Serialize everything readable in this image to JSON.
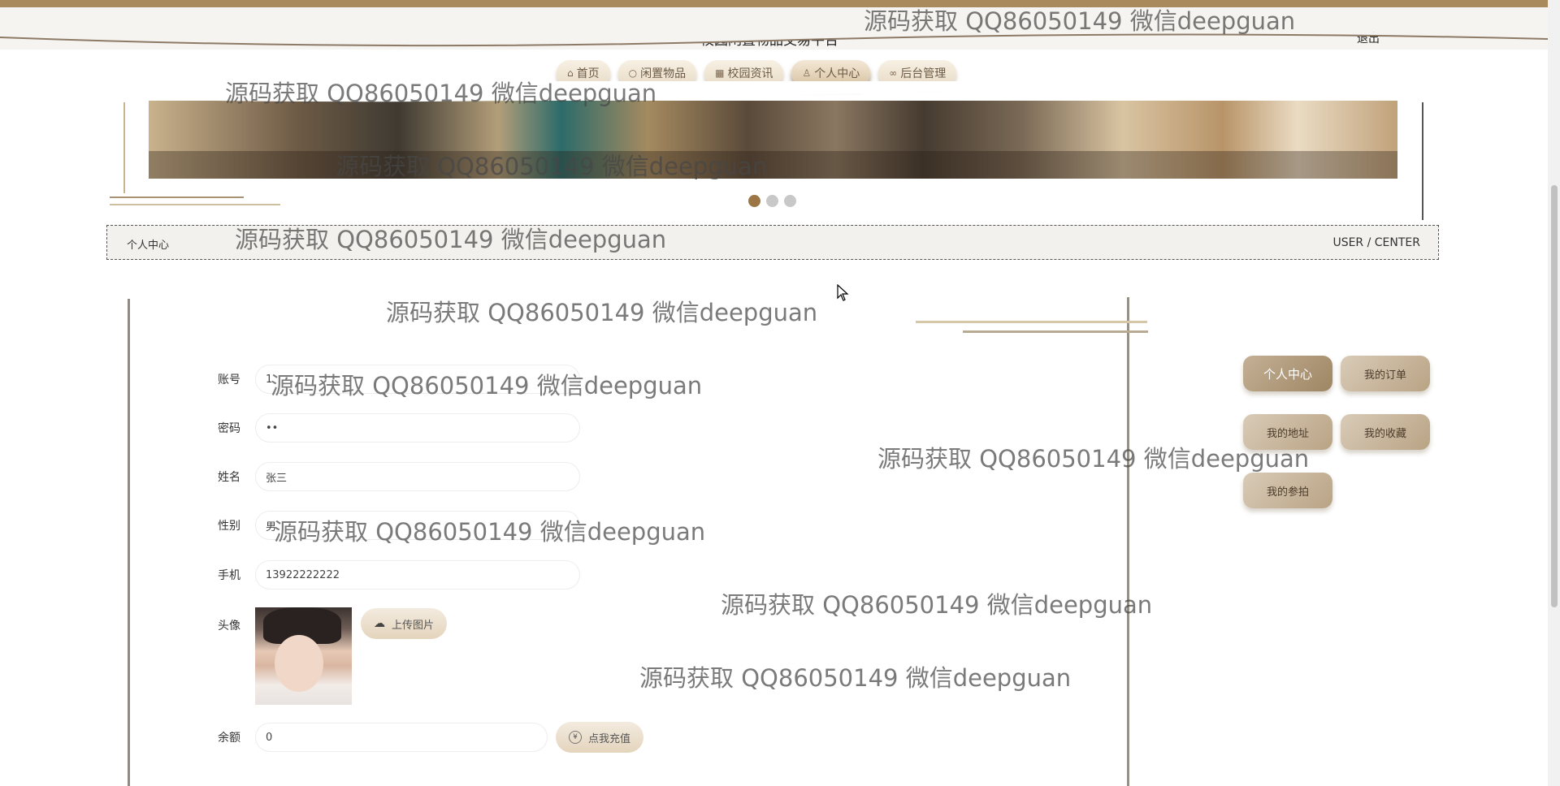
{
  "header": {
    "title": "校园闲置物品交易平台",
    "logout": "退出"
  },
  "nav": [
    {
      "label": "首页",
      "icon": "home-icon",
      "glyph": "⌂"
    },
    {
      "label": "闲置物品",
      "icon": "circle-icon",
      "glyph": "○"
    },
    {
      "label": "校园资讯",
      "icon": "grid-icon",
      "glyph": "▦"
    },
    {
      "label": "个人中心",
      "icon": "user-icon",
      "glyph": "♙"
    },
    {
      "label": "后台管理",
      "icon": "link-icon",
      "glyph": "∞"
    }
  ],
  "active_nav": "个人中心",
  "carousel": {
    "slides": 3,
    "active": 1
  },
  "section": {
    "title": "个人中心",
    "subtitle": "USER / CENTER"
  },
  "form": {
    "account_label": "账号",
    "account_value": "1",
    "password_label": "密码",
    "password_value": "••",
    "name_label": "姓名",
    "name_value": "张三",
    "gender_label": "性别",
    "gender_value": "男",
    "phone_label": "手机",
    "phone_value": "13922222222",
    "avatar_label": "头像",
    "upload_label": "上传图片",
    "balance_label": "余额",
    "balance_value": "0",
    "recharge_label": "点我充值"
  },
  "sidebar": {
    "items": [
      "个人中心",
      "我的订单",
      "我的地址",
      "我的收藏",
      "我的参拍"
    ],
    "active": "个人中心"
  },
  "watermark": "源码获取 QQ86050149 微信deepguan",
  "colors": {
    "accent": "#a88a5c",
    "active_dot": "#9c7645",
    "button": "#e4d4bc"
  }
}
